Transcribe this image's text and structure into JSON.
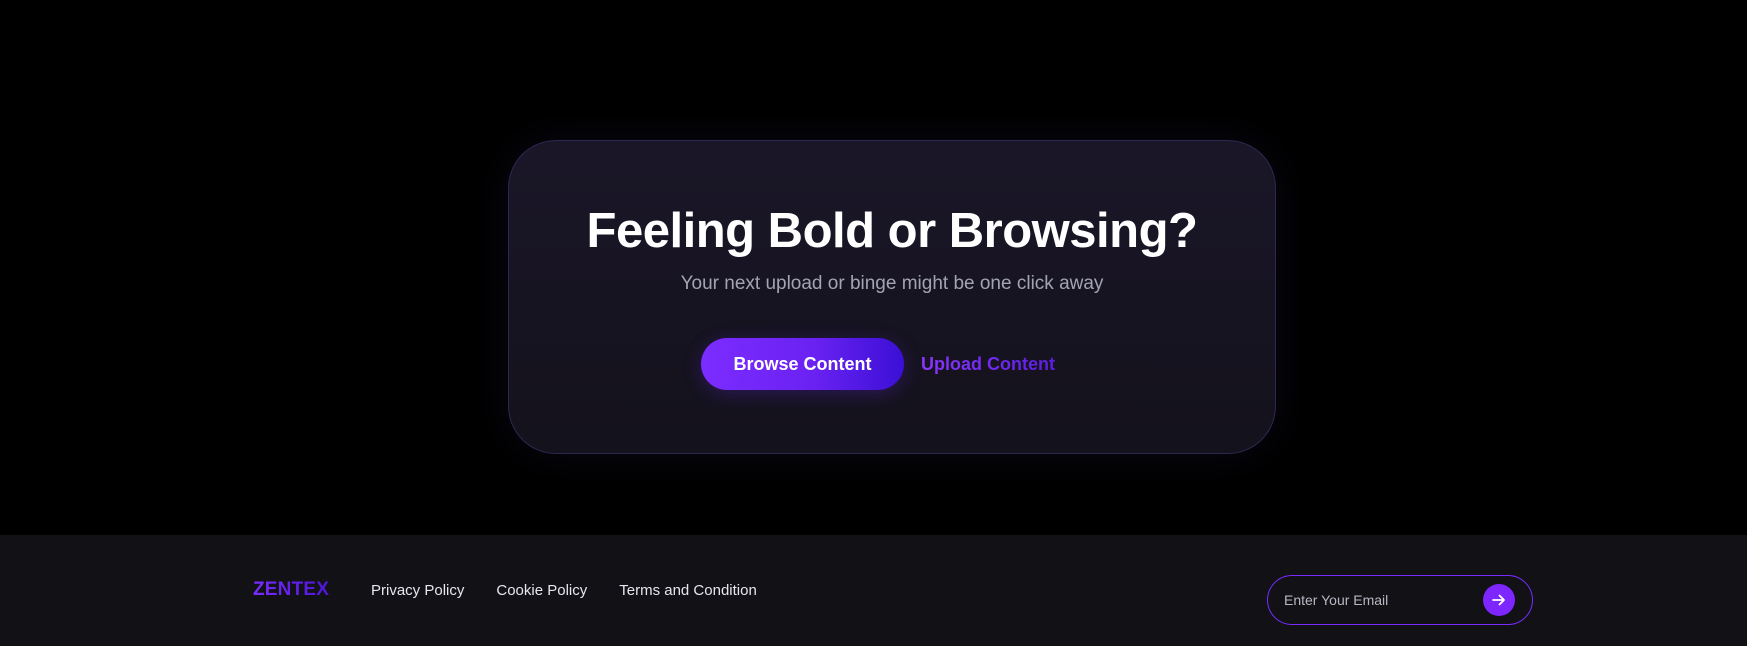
{
  "cta": {
    "title": "Feeling Bold or Browsing?",
    "subtitle": "Your next upload or binge might be one click away",
    "primary_button": "Browse Content",
    "secondary_link": "Upload Content"
  },
  "footer": {
    "logo": "ZENTEX",
    "links": [
      {
        "label": "Privacy Policy"
      },
      {
        "label": "Cookie Policy"
      },
      {
        "label": "Terms and Condition"
      }
    ],
    "newsletter": {
      "placeholder": "Enter Your Email",
      "value": "",
      "submit_icon": "arrow-right-icon"
    }
  },
  "colors": {
    "background": "#000000",
    "card": "#1a1628",
    "accent": "#7c2cff",
    "footer_bg": "#111116",
    "text_primary": "#ffffff",
    "text_secondary": "#a2a4b4"
  }
}
